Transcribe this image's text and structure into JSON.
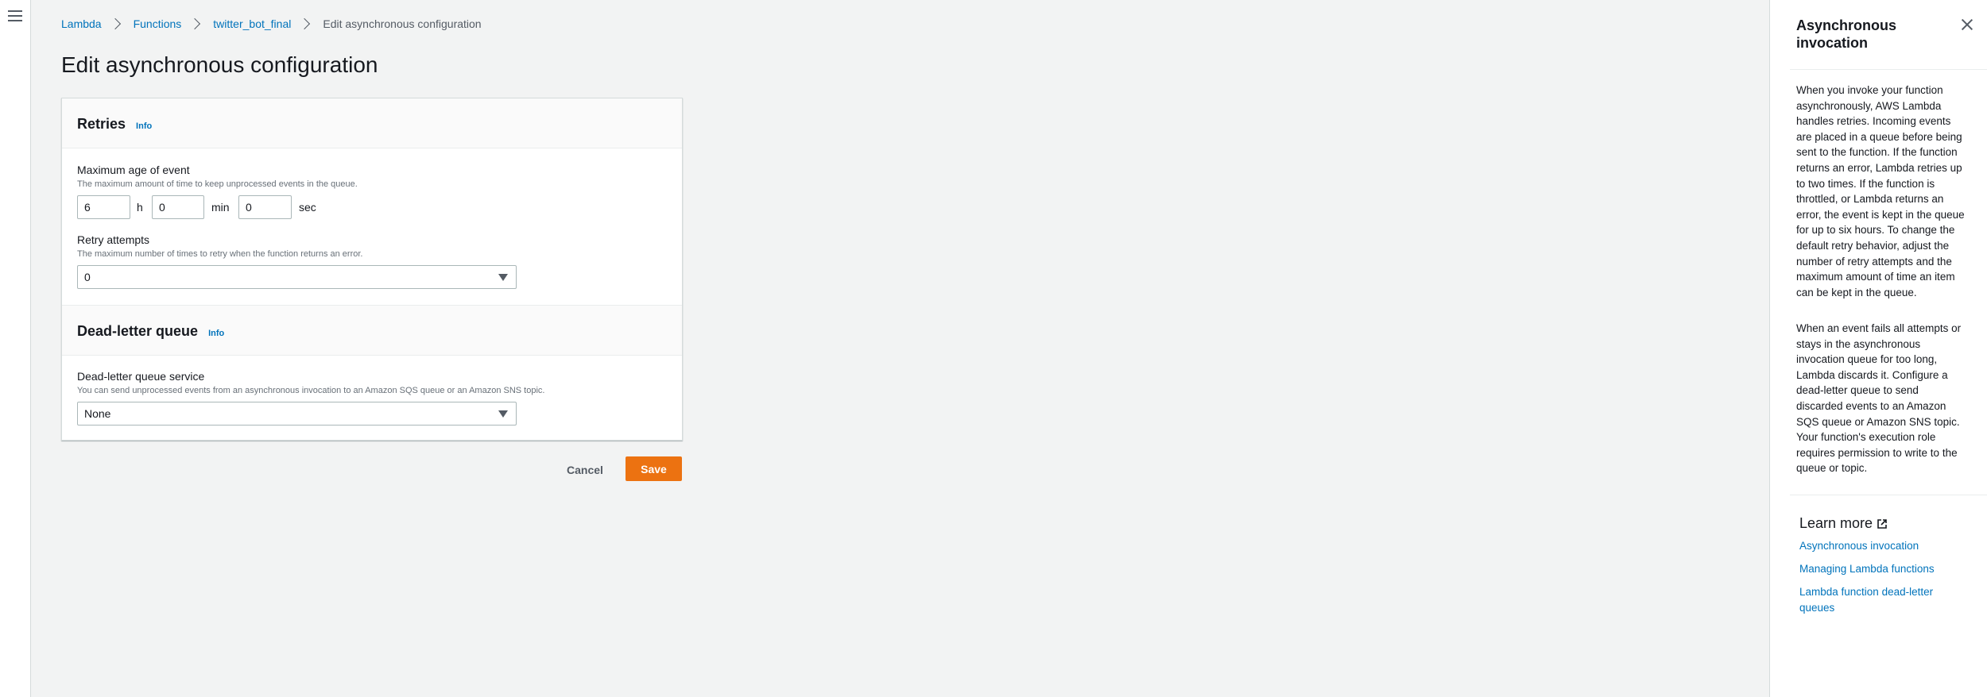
{
  "breadcrumb": {
    "items": [
      "Lambda",
      "Functions",
      "twitter_bot_final"
    ],
    "current": "Edit asynchronous configuration"
  },
  "page_title": "Edit asynchronous configuration",
  "retries": {
    "title": "Retries",
    "info": "Info",
    "max_age": {
      "label": "Maximum age of event",
      "description": "The maximum amount of time to keep unprocessed events in the queue.",
      "hours": "6",
      "hours_unit": "h",
      "minutes": "0",
      "minutes_unit": "min",
      "seconds": "0",
      "seconds_unit": "sec"
    },
    "retry_attempts": {
      "label": "Retry attempts",
      "description": "The maximum number of times to retry when the function returns an error.",
      "value": "0"
    }
  },
  "dlq": {
    "title": "Dead-letter queue",
    "info": "Info",
    "service": {
      "label": "Dead-letter queue service",
      "description": "You can send unprocessed events from an asynchronous invocation to an Amazon SQS queue or an Amazon SNS topic.",
      "value": "None"
    }
  },
  "actions": {
    "cancel": "Cancel",
    "save": "Save"
  },
  "help": {
    "title": "Asynchronous invocation",
    "paragraphs": [
      "When you invoke your function asynchronously, AWS Lambda handles retries. Incoming events are placed in a queue before being sent to the function. If the function returns an error, Lambda retries up to two times. If the function is throttled, or Lambda returns an error, the event is kept in the queue for up to six hours. To change the default retry behavior, adjust the number of retry attempts and the maximum amount of time an item can be kept in the queue.",
      "When an event fails all attempts or stays in the asynchronous invocation queue for too long, Lambda discards it. Configure a dead-letter queue to send discarded events to an Amazon SQS queue or Amazon SNS topic. Your function's execution role requires permission to write to the queue or topic."
    ],
    "learn_more": "Learn more",
    "links": [
      "Asynchronous invocation",
      "Managing Lambda functions",
      "Lambda function dead-letter queues"
    ]
  },
  "colors": {
    "accent": "#0073bb",
    "primary_button": "#ec7211",
    "background": "#f2f3f3"
  }
}
